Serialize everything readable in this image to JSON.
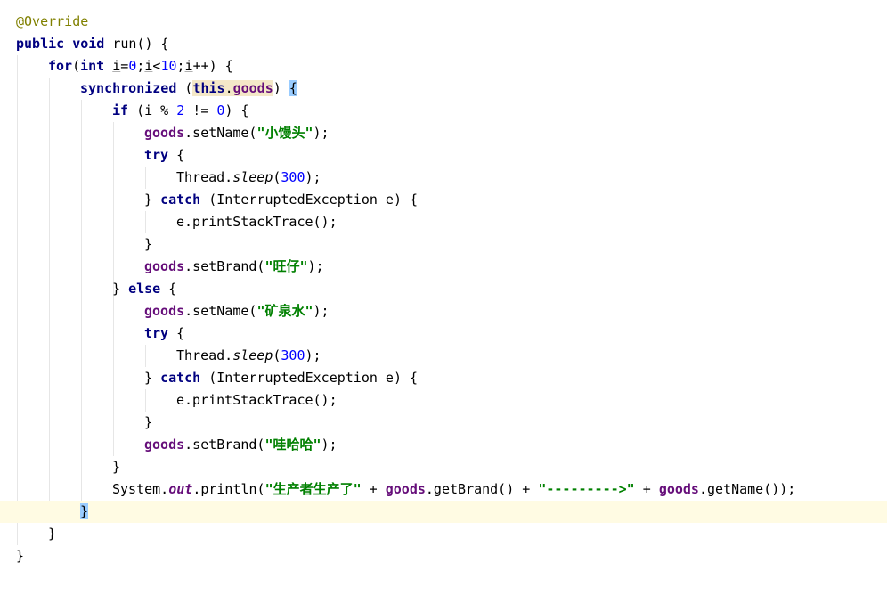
{
  "editor": {
    "lines": [
      {
        "t1": "@Override"
      },
      {
        "t1": "public",
        "t2": "void",
        "t3": " run() {"
      },
      {
        "t1": "for",
        "t2": "(",
        "t3": "int",
        "t4": " ",
        "t5": "i",
        "t6": "=",
        "t7": "0",
        "t8": ";",
        "t9": "i",
        "t10": "<",
        "t11": "10",
        "t12": ";",
        "t13": "i",
        "t14": "++) {"
      },
      {
        "t1": "synchronized",
        "t2": " (",
        "t3": "this",
        "t4": ".",
        "t5": "goods",
        "t6": ") ",
        "t7": "{"
      },
      {
        "t1": "if",
        "t2": " (i % ",
        "t3": "2",
        "t4": " != ",
        "t5": "0",
        "t6": ") {"
      },
      {
        "t1": "goods",
        "t2": ".setName(",
        "t3": "\"小馒头\"",
        "t4": ");"
      },
      {
        "t1": "try",
        "t2": " {"
      },
      {
        "t1": "Thread.",
        "t2": "sleep",
        "t3": "(",
        "t4": "300",
        "t5": ");"
      },
      {
        "t1": "} ",
        "t2": "catch",
        "t3": " (InterruptedException e) {"
      },
      {
        "t1": "e.printStackTrace();"
      },
      {
        "t1": "}"
      },
      {
        "t1": "goods",
        "t2": ".setBrand(",
        "t3": "\"旺仔\"",
        "t4": ");"
      },
      {
        "t1": "} ",
        "t2": "else",
        "t3": " {"
      },
      {
        "t1": "goods",
        "t2": ".setName(",
        "t3": "\"矿泉水\"",
        "t4": ");"
      },
      {
        "t1": "try",
        "t2": " {"
      },
      {
        "t1": "Thread.",
        "t2": "sleep",
        "t3": "(",
        "t4": "300",
        "t5": ");"
      },
      {
        "t1": "} ",
        "t2": "catch",
        "t3": " (InterruptedException e) {"
      },
      {
        "t1": "e.printStackTrace();"
      },
      {
        "t1": "}"
      },
      {
        "t1": "goods",
        "t2": ".setBrand(",
        "t3": "\"哇哈哈\"",
        "t4": ");"
      },
      {
        "t1": "}"
      },
      {
        "t1": "System.",
        "t2": "out",
        "t3": ".println(",
        "t4": "\"生产者生产了\"",
        "t5": " + ",
        "t6": "goods",
        "t7": ".getBrand() + ",
        "t8": "\"--------->\"",
        "t9": " + ",
        "t10": "goods",
        "t11": ".getName());"
      },
      {
        "t1": "}"
      },
      {
        "t1": "}"
      },
      {
        "t1": "}"
      }
    ]
  },
  "colors": {
    "keyword": "#000080",
    "field": "#660e7a",
    "number": "#0000ff",
    "string": "#008000",
    "annotation": "#808000",
    "current_line": "#fffbe3",
    "brace_match": "#99ccff"
  }
}
